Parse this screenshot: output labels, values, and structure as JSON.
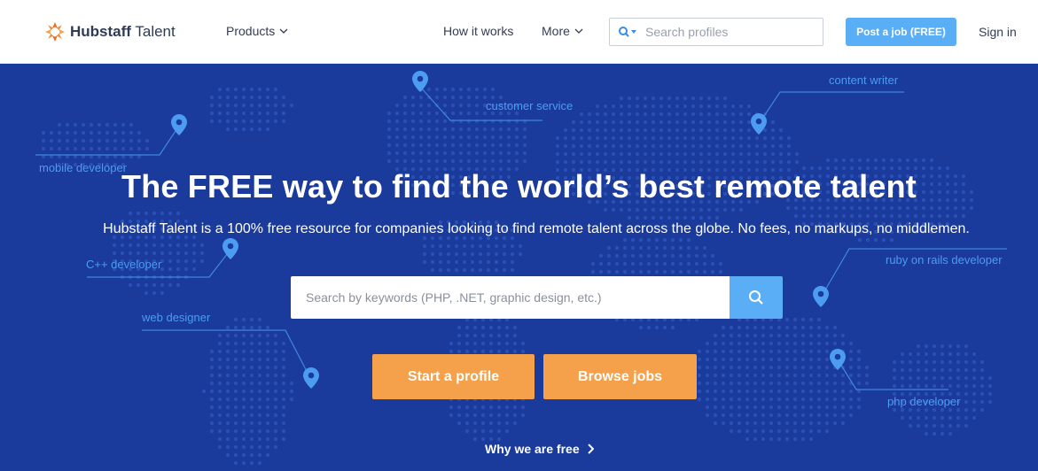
{
  "header": {
    "logo": {
      "bold": "Hubstaff",
      "light": "Talent"
    },
    "nav": {
      "products": "Products",
      "how_it_works": "How it works",
      "more": "More"
    },
    "search": {
      "placeholder": "Search profiles",
      "icon": "search-icon"
    },
    "post_job": "Post a job (FREE)",
    "sign_in": "Sign in"
  },
  "hero": {
    "title": "The FREE way to find the world’s best remote talent",
    "subtitle": "Hubstaff Talent is a 100% free resource for companies looking to find remote talent across the globe. No fees, no markups, no middlemen.",
    "search": {
      "placeholder": "Search by keywords (PHP, .NET, graphic design, etc.)",
      "icon": "search-icon"
    },
    "start_profile": "Start a profile",
    "browse_jobs": "Browse jobs",
    "why_free": "Why we are free",
    "tags": {
      "customer_service": "customer service",
      "content_writer": "content writer",
      "mobile_developer": "mobile developer",
      "cpp_developer": "C++ developer",
      "ruby_developer": "ruby on rails developer",
      "web_designer": "web designer",
      "php_developer": "php developer"
    }
  },
  "colors": {
    "hero_bg": "#1a3a9c",
    "accent_blue": "#5aaef5",
    "cta_orange": "#f5a04b",
    "tag_blue": "#4c9cf2"
  }
}
